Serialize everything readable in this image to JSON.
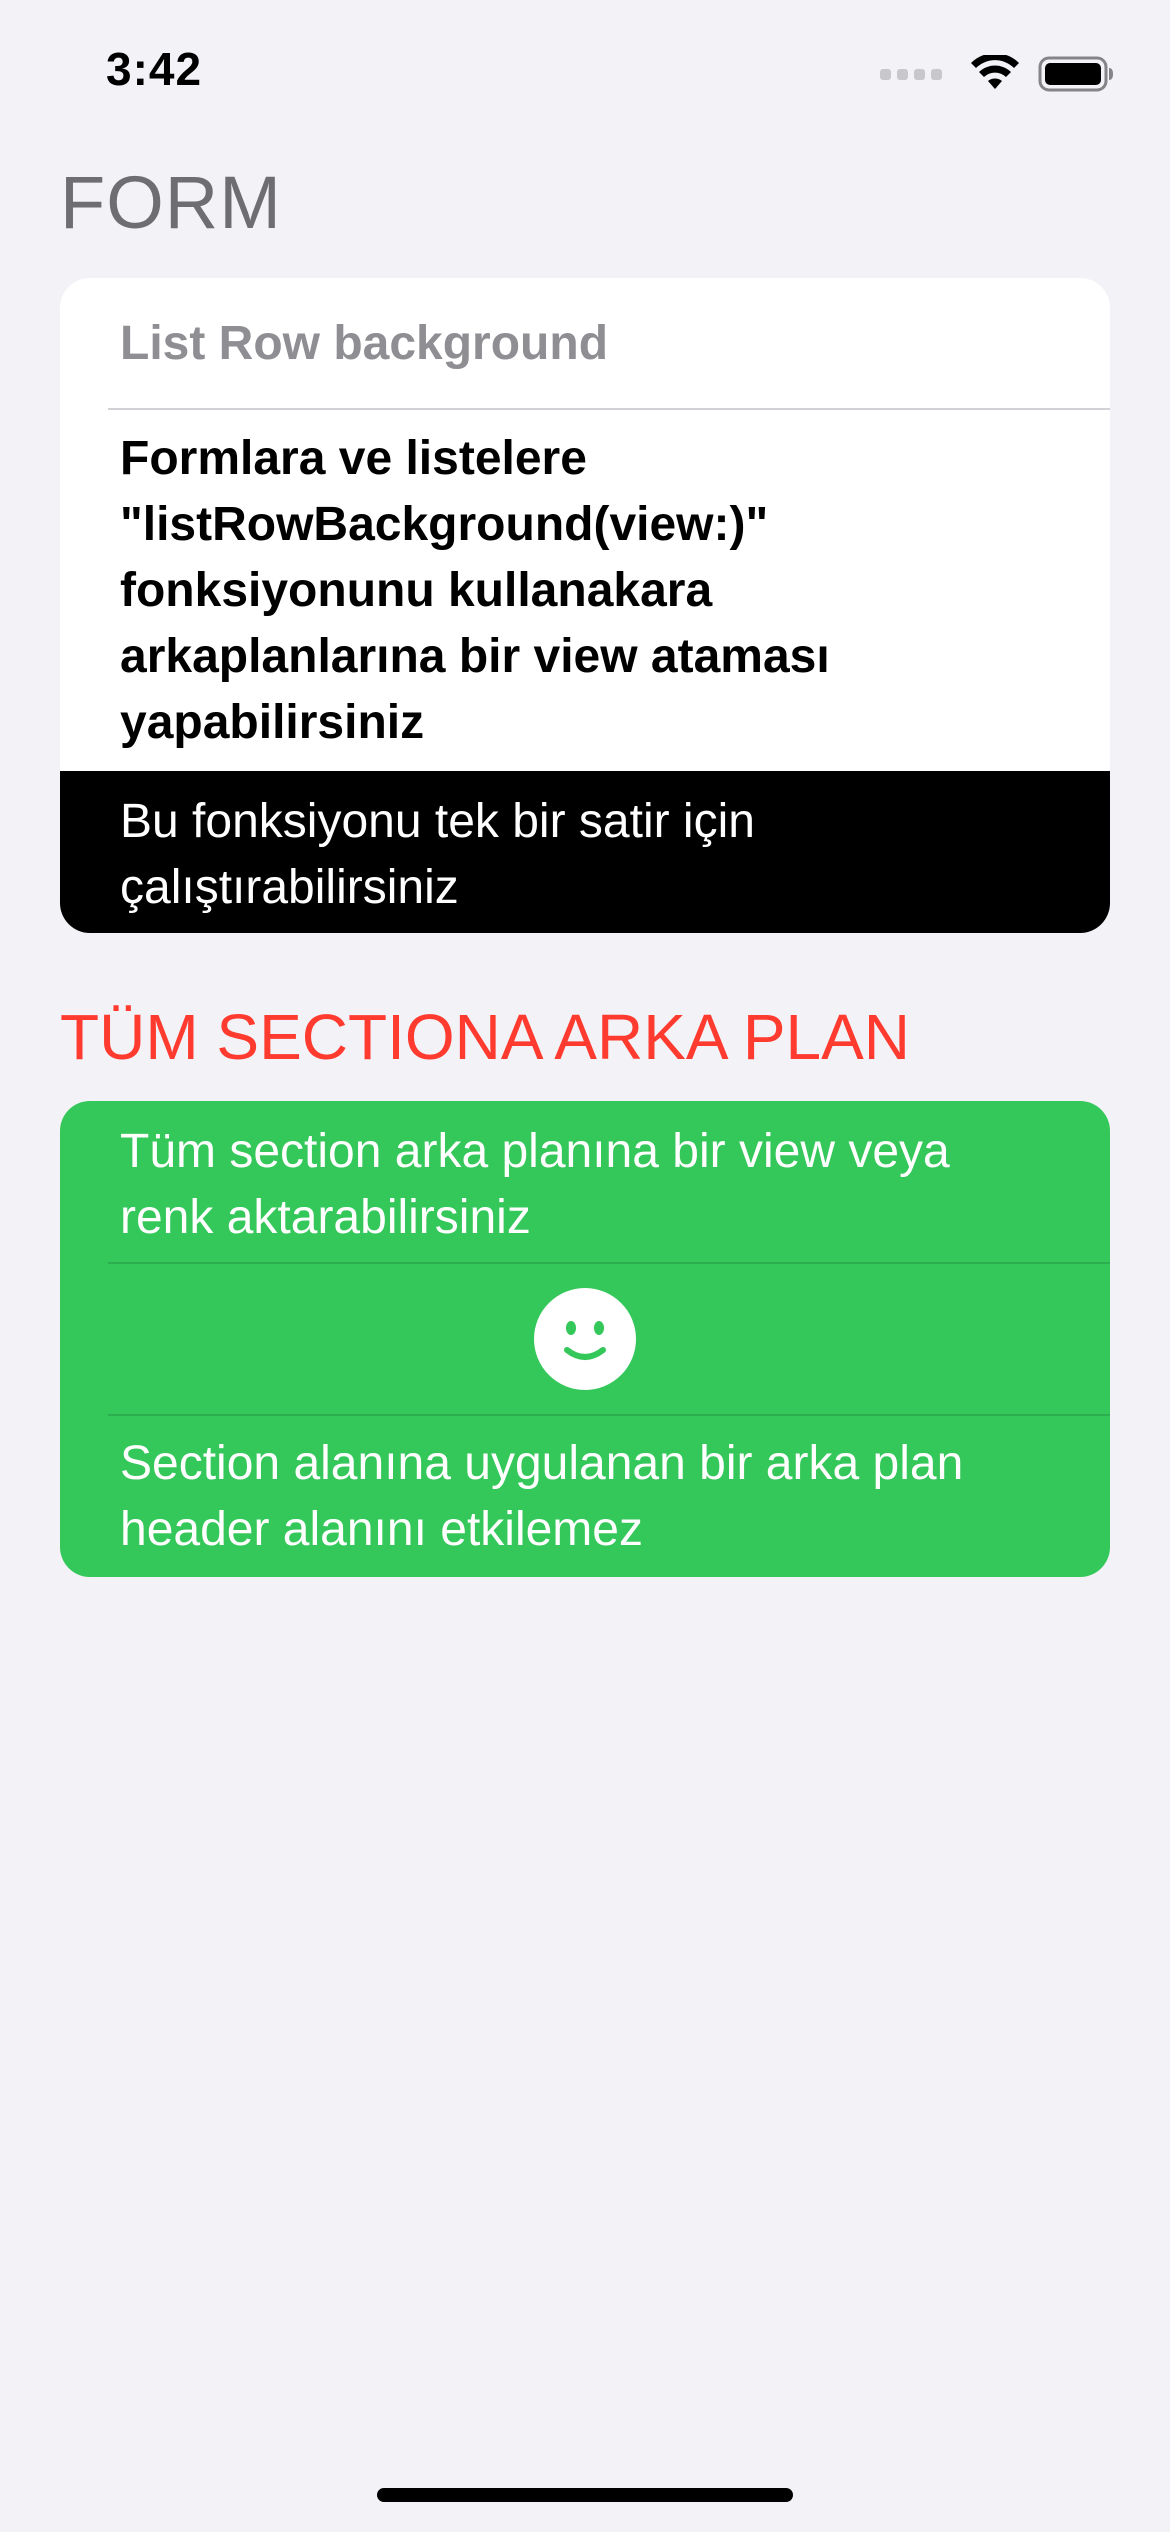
{
  "status_bar": {
    "time": "3:42",
    "icons": [
      "signal-dots-icon",
      "wifi-icon",
      "battery-icon"
    ]
  },
  "form_section": {
    "header": "FORM",
    "rows": [
      {
        "text": "List Row background"
      },
      {
        "text": "Formlara ve listelere \"listRowBackground(view:)\" fonksiyonunu kullanakara arkaplanlarına bir view ataması yapabilirsiniz"
      },
      {
        "text": "Bu fonksiyonu tek bir satir için çalıştırabilirsiniz"
      }
    ]
  },
  "green_section": {
    "header": "TÜM SECTIONA ARKA PLAN",
    "rows": [
      {
        "text": "Tüm section arka planına bir view veya renk aktarabilirsiniz"
      },
      {
        "icon": "smiley-face-icon"
      },
      {
        "text": "Section alanına uygulanan bir arka plan header alanını etkilemez"
      }
    ]
  },
  "colors": {
    "background": "#f2f2f7",
    "form_header": "#6d6d72",
    "section_header": "#ff3b30",
    "green_background": "#34c759",
    "black_row": "#000000"
  }
}
